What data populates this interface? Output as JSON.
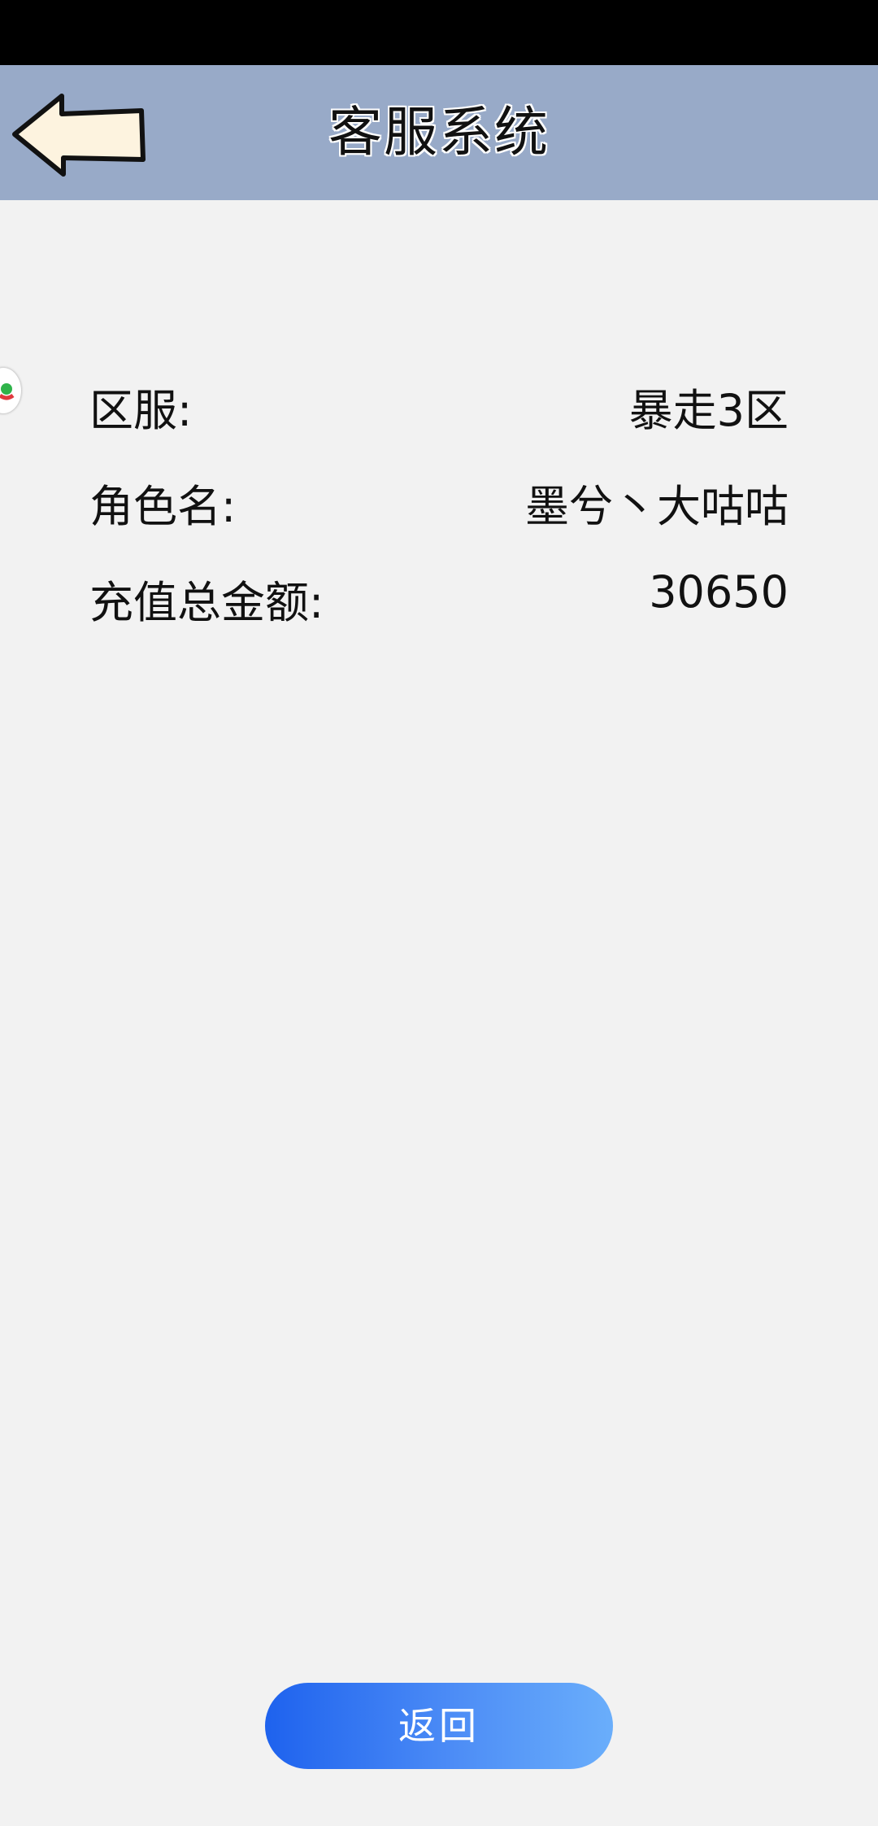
{
  "header": {
    "title": "客服系统",
    "back_icon": "left-arrow-icon"
  },
  "info": {
    "rows": [
      {
        "label": "区服:",
        "value": "暴走3区"
      },
      {
        "label": "角色名:",
        "value": "墨兮丶大咕咕"
      },
      {
        "label": "充值总金额:",
        "value": "30650"
      }
    ]
  },
  "footer": {
    "return_label": "返回"
  },
  "colors": {
    "header_bg": "#98aac8",
    "page_bg": "#f2f2f2",
    "button_gradient_start": "#1e62ee",
    "button_gradient_end": "#6aaefb",
    "arrow_fill": "#fdf3df"
  }
}
